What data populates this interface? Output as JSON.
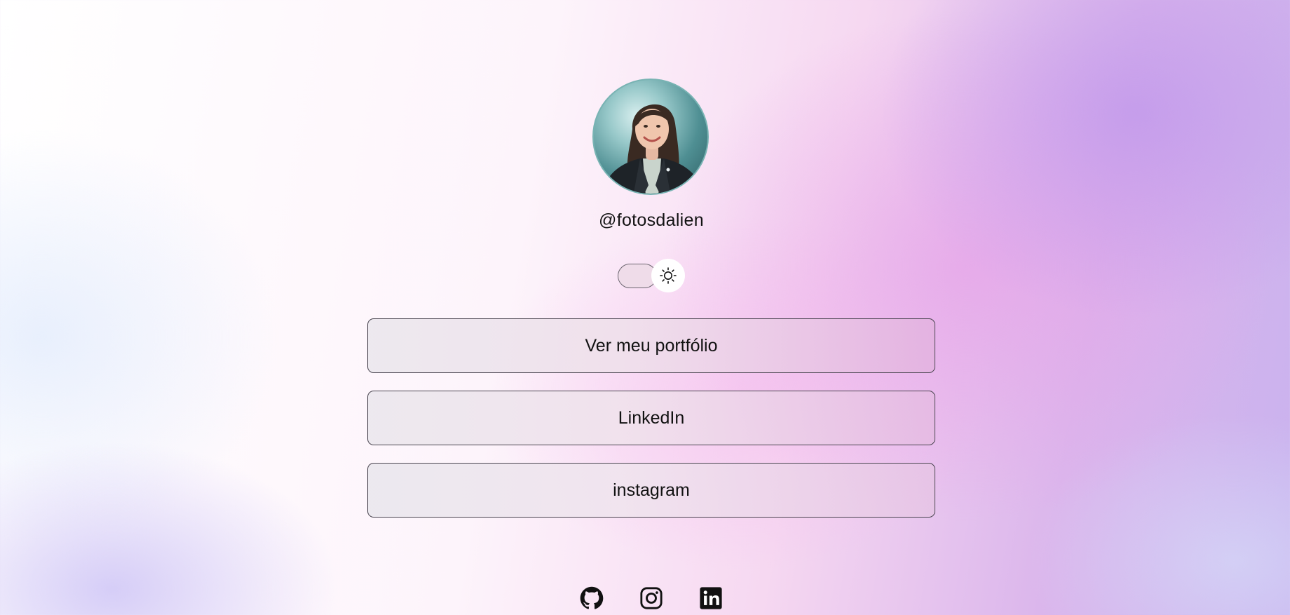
{
  "profile": {
    "username": "@fotosdalien",
    "avatar_alt": "profile photo"
  },
  "theme_toggle": {
    "icon": "sun-icon",
    "mode": "light"
  },
  "links": [
    {
      "label": "Ver meu portfólio"
    },
    {
      "label": "LinkedIn"
    },
    {
      "label": "instagram"
    }
  ],
  "social": [
    {
      "icon": "github-icon"
    },
    {
      "icon": "instagram-icon"
    },
    {
      "icon": "linkedin-icon"
    }
  ],
  "colors": {
    "text": "#121212",
    "button_border": "#4a4550",
    "avatar_ring": "#78b3b3"
  }
}
